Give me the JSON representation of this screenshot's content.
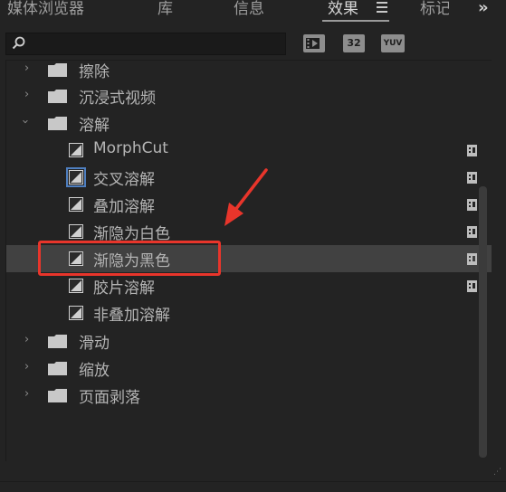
{
  "tabs": {
    "items": [
      {
        "label": "媒体浏览器",
        "active": false
      },
      {
        "label": "库",
        "active": false
      },
      {
        "label": "信息",
        "active": false
      },
      {
        "label": "效果",
        "active": true
      },
      {
        "label": "标记",
        "active": false
      }
    ],
    "menu_icon": "hamburger-menu-icon",
    "overflow_label": "»"
  },
  "search": {
    "value": "",
    "placeholder": "",
    "icon": "search-icon"
  },
  "filters": {
    "accelerated_label": "",
    "bit32_label": "32",
    "yuv_label": "YUV"
  },
  "tree": {
    "items": [
      {
        "label": "擦除",
        "type": "folder",
        "expanded": false
      },
      {
        "label": "沉浸式视频",
        "type": "folder",
        "expanded": false
      },
      {
        "label": "溶解",
        "type": "folder",
        "expanded": true
      },
      {
        "label": "MorphCut",
        "type": "effect"
      },
      {
        "label": "交叉溶解",
        "type": "effect",
        "default": true
      },
      {
        "label": "叠加溶解",
        "type": "effect"
      },
      {
        "label": "渐隐为白色",
        "type": "effect"
      },
      {
        "label": "渐隐为黑色",
        "type": "effect",
        "selected": true
      },
      {
        "label": "胶片溶解",
        "type": "effect"
      },
      {
        "label": "非叠加溶解",
        "type": "effect"
      },
      {
        "label": "滑动",
        "type": "folder",
        "expanded": false
      },
      {
        "label": "缩放",
        "type": "folder",
        "expanded": false
      },
      {
        "label": "页面剥落",
        "type": "folder",
        "expanded": false
      }
    ]
  },
  "colors": {
    "background": "#232323",
    "selected_row": "#414141",
    "annotation_red": "#e8352b",
    "default_outline": "#4f7fc0"
  }
}
